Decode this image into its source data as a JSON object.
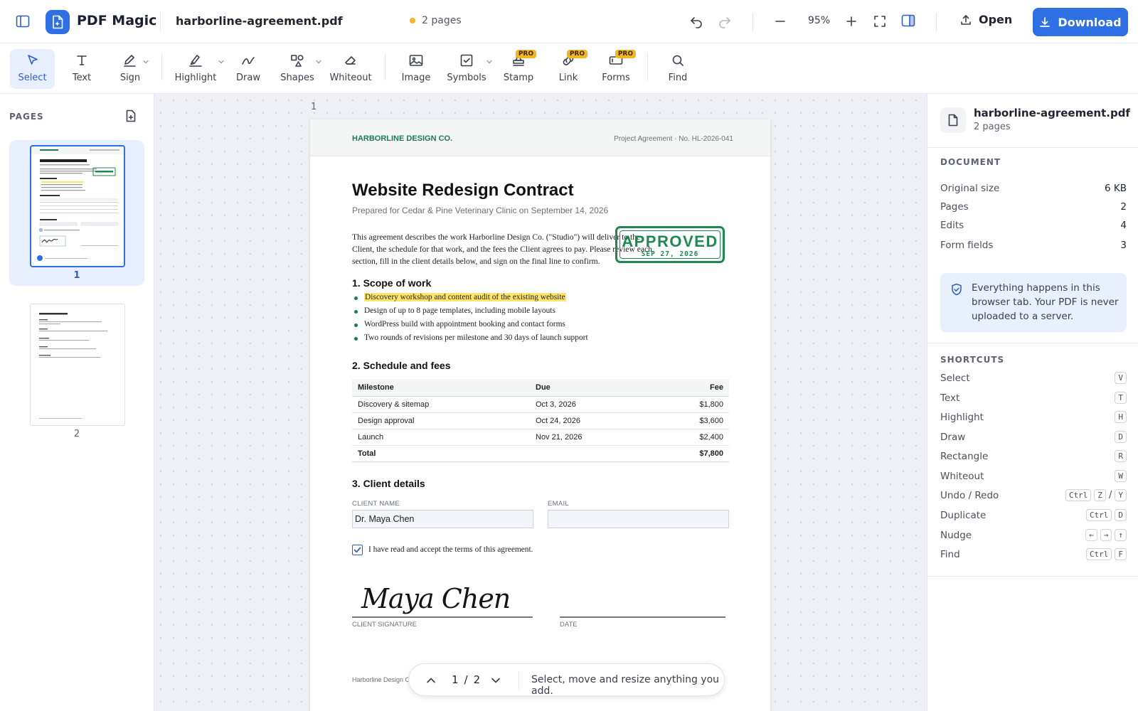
{
  "app": {
    "brand": "PDF Magic",
    "filename": "harborline-agreement.pdf",
    "page_count_label": "2 pages",
    "zoom": "95%",
    "open_label": "Open",
    "download_label": "Download",
    "accent": "#2f6fe4"
  },
  "toolbar": {
    "tools": [
      {
        "label": "Select",
        "icon": "cursor-icon"
      },
      {
        "label": "Text",
        "icon": "text-t-icon"
      },
      {
        "label": "Sign",
        "icon": "pen-icon"
      },
      {
        "label": "Highlight",
        "icon": "highlighter-icon"
      },
      {
        "label": "Draw",
        "icon": "squiggle-icon"
      },
      {
        "label": "Shapes",
        "icon": "shapes-icon"
      },
      {
        "label": "Whiteout",
        "icon": "eraser-icon"
      },
      {
        "label": "Image",
        "icon": "image-icon"
      },
      {
        "label": "Symbols",
        "icon": "checkbox-icon"
      },
      {
        "label": "Stamp",
        "icon": "stamp-icon"
      },
      {
        "label": "Link",
        "icon": "link-icon"
      },
      {
        "label": "Forms",
        "icon": "form-icon"
      },
      {
        "label": "Find",
        "icon": "search-icon"
      }
    ],
    "pro_badge": "PRO"
  },
  "sidebar": {
    "title": "PAGES",
    "thumbs": [
      "1",
      "2"
    ]
  },
  "canvas": {
    "page_label": "1"
  },
  "doc": {
    "company": "HARBORLINE DESIGN CO.",
    "meta": "Project Agreement  ·  No. HL-2026-041",
    "title": "Website Redesign Contract",
    "subtitle": "Prepared for Cedar & Pine Veterinary Clinic on September 14, 2026",
    "intro": "This agreement describes the work Harborline Design Co. (\"Studio\") will deliver to the Client, the schedule for that work, and the fees the Client agrees to pay. Please review each section, fill in the client details below, and sign on the final line to confirm.",
    "sec1": "1. Scope of work",
    "scope": [
      "Discovery workshop and content audit of the existing website",
      "Design of up to 8 page templates, including mobile layouts",
      "WordPress build with appointment booking and contact forms",
      "Two rounds of revisions per milestone and 30 days of launch support"
    ],
    "sec2": "2. Schedule and fees",
    "table": {
      "headers": [
        "Milestone",
        "Due",
        "Fee"
      ],
      "rows": [
        [
          "Discovery & sitemap",
          "Oct 3, 2026",
          "$1,800"
        ],
        [
          "Design approval",
          "Oct 24, 2026",
          "$3,600"
        ],
        [
          "Launch",
          "Nov 21, 2026",
          "$2,400"
        ]
      ],
      "total": [
        "Total",
        "",
        "$7,800"
      ]
    },
    "sec3": "3. Client details",
    "client_name_label": "CLIENT NAME",
    "client_name_value": "Dr. Maya Chen",
    "email_label": "EMAIL",
    "email_value": "",
    "accept_label": "I have read and accept the terms of this agreement.",
    "signature": "Maya Chen",
    "sig_label": "CLIENT SIGNATURE",
    "date_label": "DATE",
    "footer": "Harborline Design C",
    "stamp": {
      "text": "APPROVED",
      "date": "SEP 27, 2026",
      "color": "#1f8a4f"
    }
  },
  "pager": {
    "current": "1",
    "sep": "/",
    "total": "2",
    "hint": "Select, move and resize anything you add."
  },
  "rpanel": {
    "filename": "harborline-agreement.pdf",
    "pages": "2 pages",
    "doc_title": "DOCUMENT",
    "stats": [
      {
        "label": "Original size",
        "value": "6 KB"
      },
      {
        "label": "Pages",
        "value": "2"
      },
      {
        "label": "Edits",
        "value": "4"
      },
      {
        "label": "Form fields",
        "value": "3"
      }
    ],
    "privacy_note": "Everything happens in this browser tab. Your PDF is never uploaded to a server.",
    "shortcuts_title": "SHORTCUTS",
    "shortcuts": [
      {
        "label": "Select",
        "keys": [
          "V"
        ]
      },
      {
        "label": "Text",
        "keys": [
          "T"
        ]
      },
      {
        "label": "Highlight",
        "keys": [
          "H"
        ]
      },
      {
        "label": "Draw",
        "keys": [
          "D"
        ]
      },
      {
        "label": "Rectangle",
        "keys": [
          "R"
        ]
      },
      {
        "label": "Whiteout",
        "keys": [
          "W"
        ]
      },
      {
        "label": "Undo / Redo",
        "keys": [
          "Ctrl",
          "Z",
          "/",
          "Y"
        ]
      },
      {
        "label": "Duplicate",
        "keys": [
          "Ctrl",
          "D"
        ]
      },
      {
        "label": "Nudge",
        "keys": [
          "←",
          "→",
          "↑"
        ]
      },
      {
        "label": "Find",
        "keys": [
          "Ctrl",
          "F"
        ]
      }
    ]
  }
}
